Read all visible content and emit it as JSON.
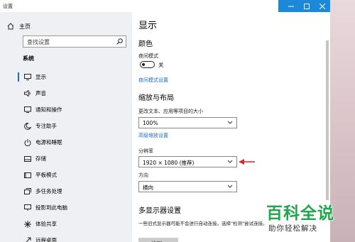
{
  "window": {
    "title": "设置"
  },
  "nav": {
    "home_label": "主页",
    "search_placeholder": "查找设置",
    "section_label": "系统",
    "items": [
      {
        "label": "显示",
        "icon": "monitor-icon",
        "active": true
      },
      {
        "label": "声音",
        "icon": "speaker-icon"
      },
      {
        "label": "通知和操作",
        "icon": "notification-icon"
      },
      {
        "label": "专注助手",
        "icon": "moon-icon"
      },
      {
        "label": "电源和睡眠",
        "icon": "power-icon"
      },
      {
        "label": "存储",
        "icon": "storage-icon"
      },
      {
        "label": "平板模式",
        "icon": "tablet-icon"
      },
      {
        "label": "多任务处理",
        "icon": "multitask-icon"
      },
      {
        "label": "投影到此电脑",
        "icon": "project-icon"
      },
      {
        "label": "体验共享",
        "icon": "share-icon"
      },
      {
        "label": "远程桌面",
        "icon": "remote-icon"
      }
    ]
  },
  "main": {
    "title": "显示",
    "color_heading": "颜色",
    "night_light_label": "夜间模式",
    "night_light_state": "关",
    "night_light_link": "夜间模式设置",
    "scale_heading": "缩放与布局",
    "scale_label": "更改文本、应用等项目的大小",
    "scale_value": "100%",
    "advanced_scale_link": "高级缩放设置",
    "resolution_label": "分辨率",
    "resolution_value": "1920 × 1080 (推荐)",
    "orientation_label": "方向",
    "orientation_value": "横向",
    "multi_display_heading": "多显示器设置",
    "multi_display_note": "一些旧式显示器可能不会进行自动连接。选择\"检测\"尝试连接。",
    "detect_button": "检测"
  },
  "watermark": {
    "brand": "百科全说",
    "tagline": "助你轻松解决"
  },
  "colors": {
    "accent": "#1b6fbf",
    "titlebar_accent": "#1b88d8",
    "arrow": "#e0242b",
    "watermark_green": "#1fa84a"
  }
}
